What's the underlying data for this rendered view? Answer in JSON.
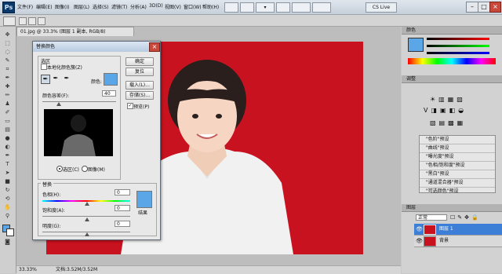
{
  "menubar": {
    "logo": "Ps",
    "items": [
      "文件(F)",
      "编辑(E)",
      "图像(I)",
      "图层(L)",
      "选择(S)",
      "滤镜(T)",
      "分析(A)",
      "3D(D)",
      "视图(V)",
      "窗口(W)",
      "帮助(H)"
    ],
    "cs_live": "CS Live"
  },
  "document": {
    "tab_title": "01.jpg @ 33.3% (图层 1 副本, RGB/8)",
    "zoom": "33.33%",
    "status": "文档:3.52M/3.52M"
  },
  "dialog": {
    "title": "替换颜色",
    "selection_group": "选区",
    "localized_clusters": "本地化颜色簇(Z)",
    "color_label": "颜色:",
    "fuzziness_label": "颜色容差(F):",
    "fuzziness_value": "40",
    "radio_selection": "选区(C)",
    "radio_image": "图像(M)",
    "ok": "确定",
    "reset": "复位",
    "load": "载入(L)...",
    "save": "存储(S)...",
    "preview": "预览(P)",
    "replacement_group": "替换",
    "hue_label": "色相(H):",
    "hue_value": "0",
    "saturation_label": "饱和度(A):",
    "saturation_value": "0",
    "lightness_label": "明度(G):",
    "lightness_value": "0",
    "result_label": "结果",
    "colors": {
      "sample": "#5aa6e6",
      "result": "#5aa6e6"
    }
  },
  "panels": {
    "color_tab": "颜色",
    "adjust_tab": "调整",
    "adjust_items": [
      "\"色阶\"预设",
      "\"曲线\"预设",
      "\"曝光度\"预设",
      "\"色相/饱和度\"预设",
      "\"黑白\"预设",
      "\"通道混合器\"预设",
      "\"可选颜色\"预设"
    ],
    "layers_tab": "图层",
    "blend_mode": "正常",
    "layers": [
      {
        "name": "图层 1",
        "selected": true
      },
      {
        "name": "背景",
        "selected": false
      }
    ]
  }
}
